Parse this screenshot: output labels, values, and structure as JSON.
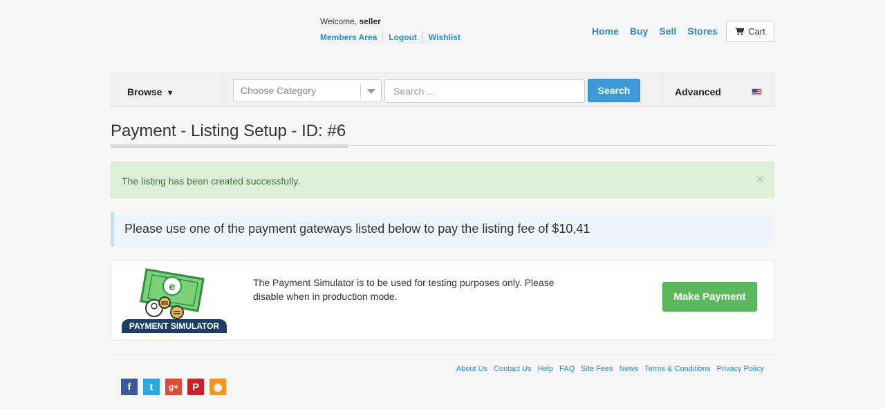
{
  "header": {
    "welcome_prefix": "Welcome,",
    "username": "seller",
    "user_links": [
      "Members Area",
      "Logout",
      "Wishlist"
    ],
    "nav": [
      "Home",
      "Buy",
      "Sell",
      "Stores"
    ],
    "cart_label": "Cart"
  },
  "searchbar": {
    "browse_label": "Browse",
    "category_placeholder": "Choose Category",
    "search_placeholder": "Search ...",
    "search_button": "Search",
    "advanced_label": "Advanced"
  },
  "page": {
    "title": "Payment - Listing Setup - ID: #6"
  },
  "alert": {
    "message": "The listing has been created successfully.",
    "close": "×"
  },
  "info": {
    "message": "Please use one of the payment gateways listed below to pay the listing fee of $10,41"
  },
  "gateway": {
    "logo_text": "PAYMENT SIMULATOR",
    "description": "The Payment Simulator is to be used for testing purposes only. Please disable when in production mode.",
    "button": "Make Payment"
  },
  "footer": {
    "links": [
      "About Us",
      "Contact Us",
      "Help",
      "FAQ",
      "Site Fees",
      "News",
      "Terms & Conditions",
      "Privacy Policy"
    ],
    "social": [
      {
        "name": "facebook-icon",
        "glyph": "f"
      },
      {
        "name": "twitter-icon",
        "glyph": "t"
      },
      {
        "name": "google-plus-icon",
        "glyph": "g+"
      },
      {
        "name": "pinterest-icon",
        "glyph": "P"
      },
      {
        "name": "rss-icon",
        "glyph": "◉"
      }
    ]
  },
  "colors": {
    "link": "#2a8bc4",
    "search_button": "#3d9ad6",
    "success_bg": "#dff0d8",
    "pay_button": "#5cb85c",
    "info_bg": "#eef5fb"
  }
}
